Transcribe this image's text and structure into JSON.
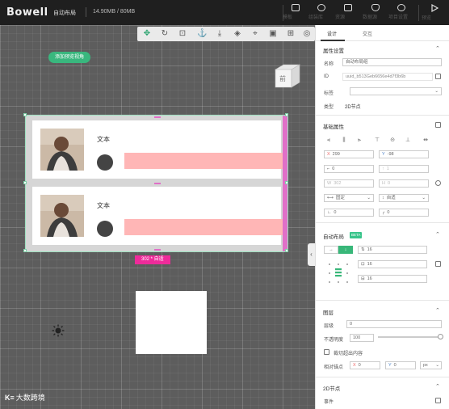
{
  "app": {
    "logo": "Bowell",
    "doc_name": "自动布局",
    "doc_size": "14.90MB / 80MB"
  },
  "toolbar": [
    {
      "label": "模板",
      "icon": "template-icon"
    },
    {
      "label": "组装库",
      "icon": "components-icon"
    },
    {
      "label": "资源",
      "icon": "resources-icon"
    },
    {
      "label": "数据源",
      "icon": "database-icon"
    },
    {
      "label": "项目设置",
      "icon": "settings-icon"
    },
    {
      "label": "预览",
      "icon": "play-icon"
    }
  ],
  "canvas": {
    "preview_button": "添加预览视角",
    "view_cube_label": "前",
    "size_badge": "302 * 自适",
    "watermark": "大数跨境",
    "cards": [
      {
        "title": "文本"
      },
      {
        "title": "文本"
      }
    ]
  },
  "panel": {
    "tabs": [
      "设计",
      "交互"
    ],
    "props": {
      "title": "属性设置",
      "name_label": "名称",
      "name_value": "自动布局组",
      "id_label": "ID",
      "id_value": "uuid_b513Geb6656e4d7f3b6b",
      "tag_label": "标签",
      "type_label": "类型",
      "type_value": "2D节点"
    },
    "style": {
      "title": "基础属性",
      "x_label": "X",
      "x_value": "299",
      "y_label": "Y",
      "y_value": "-98",
      "r_value": "0",
      "sx_value": "1",
      "w_label": "W",
      "w_value": "302",
      "h_label": "H",
      "h_value": "0",
      "fix_w": "固定",
      "fix_h": "自适",
      "angle_value": "0",
      "radius_value": "0"
    },
    "autolayout": {
      "title": "自动布局",
      "tag": "BETA",
      "gap_value": "16",
      "pad_value": "16",
      "pad2_value": "16"
    },
    "layer": {
      "title": "图层",
      "level_label": "层级",
      "level_value": "0",
      "opacity_label": "不透明度",
      "opacity_value": "100",
      "opacity": 1.0,
      "clip_label": "裁切超出内容",
      "anchor_label": "相对锚点",
      "anchor_x": "0",
      "anchor_y": "0",
      "anchor_unit": "px"
    },
    "node2d": {
      "title": "2D节点",
      "events_label": "事件"
    }
  }
}
